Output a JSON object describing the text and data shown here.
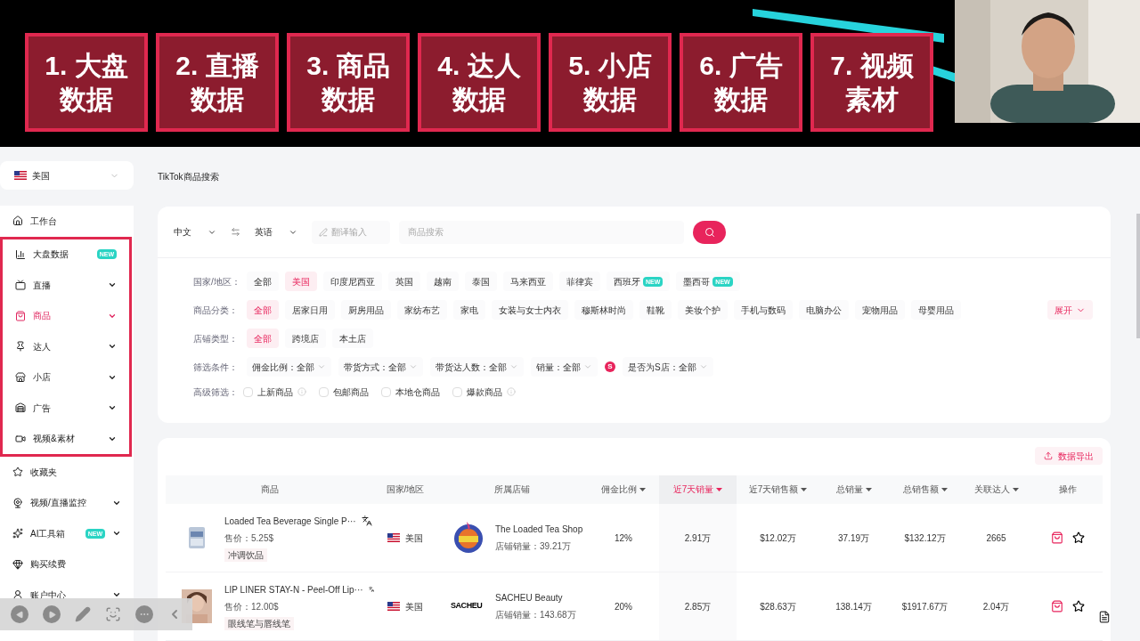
{
  "banner": {
    "tiles": [
      {
        "lines": [
          "1. 大盘",
          "数据"
        ]
      },
      {
        "lines": [
          "2. 直播",
          "数据"
        ]
      },
      {
        "lines": [
          "3. 商品",
          "数据"
        ]
      },
      {
        "lines": [
          "4. 达人",
          "数据"
        ]
      },
      {
        "lines": [
          "5. 小店",
          "数据"
        ]
      },
      {
        "lines": [
          "6. 广告",
          "数据"
        ]
      },
      {
        "lines": [
          "7. 视频",
          "素材"
        ]
      }
    ]
  },
  "sidebar": {
    "region": "美国",
    "top_items": [
      {
        "label": "工作台",
        "expandable": false,
        "selected": false
      }
    ],
    "highlighted_items": [
      {
        "label": "大盘数据",
        "badge": "NEW",
        "expandable": false,
        "selected": false
      },
      {
        "label": "直播",
        "expandable": true,
        "selected": false
      },
      {
        "label": "商品",
        "expandable": true,
        "selected": true
      },
      {
        "label": "达人",
        "expandable": true,
        "selected": false
      },
      {
        "label": "小店",
        "expandable": true,
        "selected": false
      },
      {
        "label": "广告",
        "expandable": true,
        "selected": false
      },
      {
        "label": "视频&素材",
        "expandable": true,
        "selected": false
      }
    ],
    "bottom_items": [
      {
        "label": "收藏夹",
        "expandable": false,
        "selected": false
      },
      {
        "label": "视频/直播监控",
        "expandable": true,
        "selected": false
      },
      {
        "label": "AI工具箱",
        "badge": "NEW",
        "expandable": true,
        "selected": false
      },
      {
        "label": "购买续费",
        "expandable": false,
        "selected": false
      },
      {
        "label": "账户中心",
        "expandable": true,
        "selected": false
      }
    ]
  },
  "page_title": "TikTok商品搜索",
  "search": {
    "source_language": "中文",
    "target_language": "英语",
    "translate_placeholder": "翻译输入",
    "placeholder": "商品搜索"
  },
  "filters": [
    {
      "label": "国家/地区：",
      "options": [
        {
          "label": "全部",
          "selected": false
        },
        {
          "label": "美国",
          "selected": true
        },
        {
          "label": "印度尼西亚",
          "selected": false
        },
        {
          "label": "英国",
          "selected": false
        },
        {
          "label": "越南",
          "selected": false
        },
        {
          "label": "泰国",
          "selected": false
        },
        {
          "label": "马来西亚",
          "selected": false
        },
        {
          "label": "菲律宾",
          "selected": false
        },
        {
          "label": "西班牙",
          "badge": "NEW",
          "selected": false
        },
        {
          "label": "墨西哥",
          "badge": "NEW",
          "selected": false
        }
      ]
    },
    {
      "label": "商品分类：",
      "options": [
        {
          "label": "全部",
          "selected": true
        },
        {
          "label": "居家日用",
          "selected": false
        },
        {
          "label": "厨房用品",
          "selected": false
        },
        {
          "label": "家纺布艺",
          "selected": false
        },
        {
          "label": "家电",
          "selected": false
        },
        {
          "label": "女装与女士内衣",
          "selected": false
        },
        {
          "label": "穆斯林时尚",
          "selected": false
        },
        {
          "label": "鞋靴",
          "selected": false
        },
        {
          "label": "美妆个护",
          "selected": false
        },
        {
          "label": "手机与数码",
          "selected": false
        },
        {
          "label": "电脑办公",
          "selected": false
        },
        {
          "label": "宠物用品",
          "selected": false
        },
        {
          "label": "母婴用品",
          "selected": false
        }
      ],
      "expand": "展开"
    },
    {
      "label": "店铺类型：",
      "options": [
        {
          "label": "全部",
          "selected": true
        },
        {
          "label": "跨境店",
          "selected": false
        },
        {
          "label": "本土店",
          "selected": false
        }
      ]
    }
  ],
  "conditions": {
    "label": "筛选条件：",
    "dropdowns": [
      {
        "label": "佣金比例：全部"
      },
      {
        "label": "带货方式：全部"
      },
      {
        "label": "带货达人数：全部"
      },
      {
        "label": "销量：全部"
      },
      {
        "label": "是否为S店：全部",
        "s_icon": "S"
      }
    ]
  },
  "advanced": {
    "label": "高级筛选：",
    "checkboxes": [
      {
        "label": "上新商品",
        "checked": false,
        "info": true
      },
      {
        "label": "包邮商品",
        "checked": false,
        "info": false
      },
      {
        "label": "本地仓商品",
        "checked": false,
        "info": false
      },
      {
        "label": "爆款商品",
        "checked": false,
        "info": true
      }
    ]
  },
  "export_button": "数据导出",
  "table": {
    "columns": [
      {
        "label": "商品",
        "sortable": false,
        "selected": false
      },
      {
        "label": "国家/地区",
        "sortable": false,
        "selected": false
      },
      {
        "label": "所属店铺",
        "sortable": false,
        "selected": false
      },
      {
        "label": "佣金比例",
        "sortable": true,
        "selected": false
      },
      {
        "label": "近7天销量",
        "sortable": true,
        "selected": true
      },
      {
        "label": "近7天销售额",
        "sortable": true,
        "selected": false
      },
      {
        "label": "总销量",
        "sortable": true,
        "selected": false
      },
      {
        "label": "总销售额",
        "sortable": true,
        "selected": false
      },
      {
        "label": "关联达人",
        "sortable": true,
        "selected": false
      },
      {
        "label": "操作",
        "sortable": false,
        "selected": false
      }
    ],
    "rows": [
      {
        "name": "Loaded Tea Beverage Single P···",
        "price": "售价：5.25$",
        "tag": "冲调饮品",
        "country": "美国",
        "shop": "The Loaded Tea Shop",
        "shop_sales": "店铺销量：39.21万",
        "commission": "12%",
        "sales_7d": "2.91万",
        "revenue_7d": "$12.02万",
        "total_sales": "37.19万",
        "total_revenue": "$132.12万",
        "creators": "2665"
      },
      {
        "name": "LIP LINER STAY-N - Peel-Off Lip···",
        "price": "售价：12.00$",
        "tag": "眼线笔与唇线笔",
        "country": "美国",
        "shop": "SACHEU Beauty",
        "shop_logo": "SACHEU",
        "shop_sales": "店铺销量：143.68万",
        "commission": "20%",
        "sales_7d": "2.85万",
        "revenue_7d": "$28.63万",
        "total_sales": "138.14万",
        "total_revenue": "$1917.67万",
        "creators": "2.04万"
      }
    ]
  }
}
